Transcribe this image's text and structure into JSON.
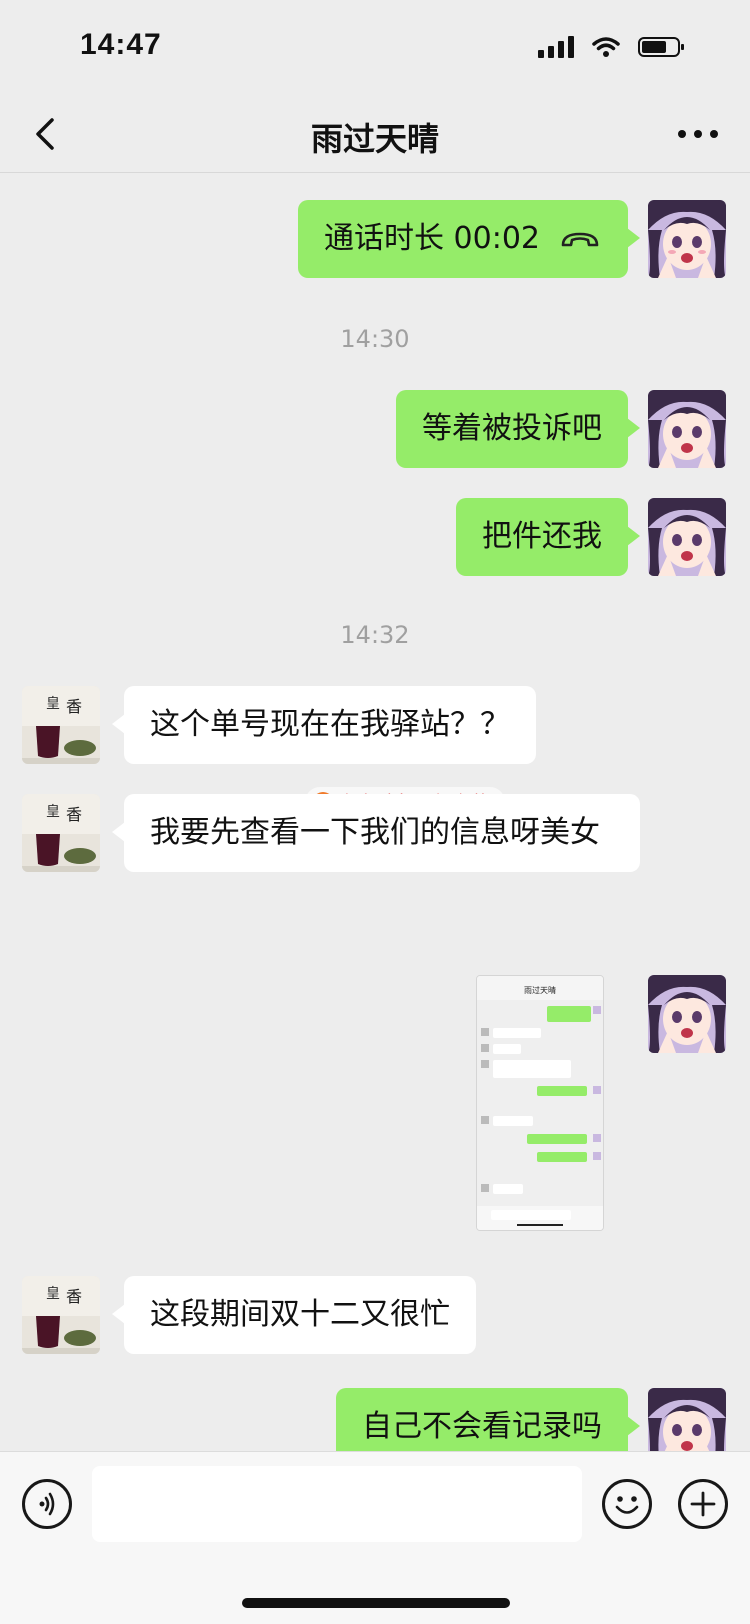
{
  "status_bar": {
    "time": "14:47"
  },
  "header": {
    "title": "雨过天晴"
  },
  "messages": [
    {
      "type": "call",
      "sender": "me",
      "text": "通话时长 00:02"
    },
    {
      "type": "timestamp",
      "text": "14:30"
    },
    {
      "type": "text",
      "sender": "me",
      "text": "等着被投诉吧"
    },
    {
      "type": "text",
      "sender": "me",
      "text": "把件还我"
    },
    {
      "type": "timestamp",
      "text": "14:32"
    },
    {
      "type": "text",
      "sender": "other",
      "text": "这个单号现在在我驿站？？"
    },
    {
      "type": "text",
      "sender": "other",
      "text": "我要先查看一下我们的信息呀美女"
    },
    {
      "type": "image",
      "sender": "me",
      "caption": "雨过天晴"
    },
    {
      "type": "text",
      "sender": "other",
      "text": "这段期间双十二又很忙"
    },
    {
      "type": "text",
      "sender": "me",
      "text": "自己不会看记录吗"
    }
  ],
  "watermark": {
    "text": "东方财富网 知东莞"
  },
  "input_bar": {
    "placeholder": ""
  },
  "colors": {
    "my_bubble": "#95ec69",
    "other_bubble": "#ffffff",
    "background": "#ededed"
  },
  "icons": [
    "back-chevron-icon",
    "more-dots-icon",
    "voice-icon",
    "emoji-icon",
    "plus-icon",
    "hangup-phone-icon"
  ]
}
